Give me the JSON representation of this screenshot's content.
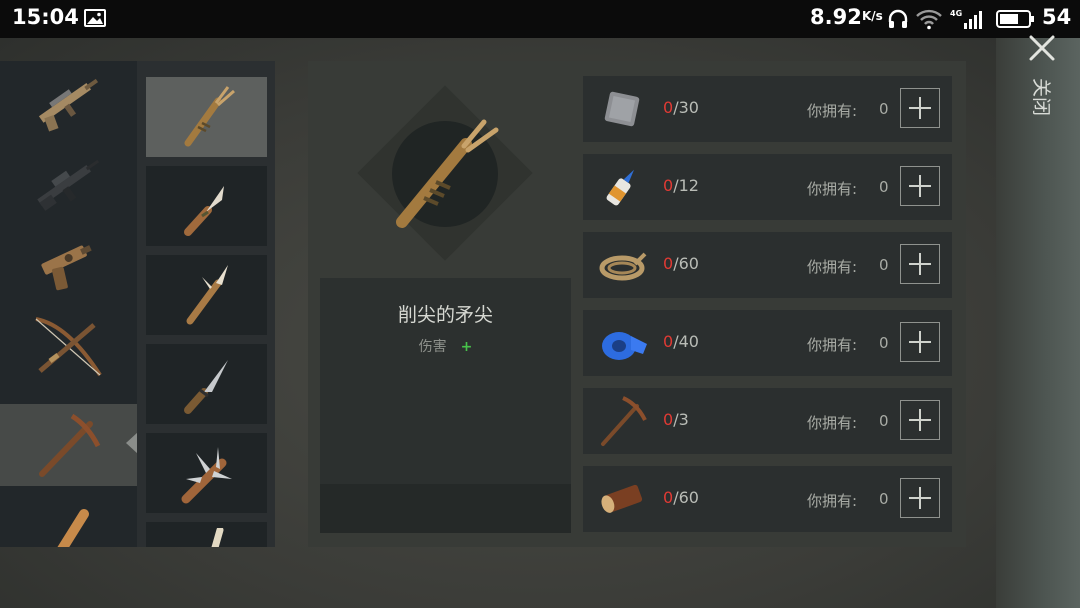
{
  "status_bar": {
    "time": "15:04",
    "speed": "8.92",
    "speed_unit": "K/s",
    "battery_level": "54",
    "icons": [
      "gallery-icon",
      "headset-icon",
      "wifi-icon",
      "signal-4g-icon",
      "battery-icon"
    ]
  },
  "categories": [
    {
      "name": "assault-rifle-icon",
      "selected": false
    },
    {
      "name": "m16-rifle-icon",
      "selected": false
    },
    {
      "name": "pistol-icon",
      "selected": false
    },
    {
      "name": "crossbow-icon",
      "selected": false
    },
    {
      "name": "pickaxe-icon",
      "selected": true
    },
    {
      "name": "bat-icon",
      "selected": false
    }
  ],
  "items": [
    {
      "name": "sharpened-spear-icon",
      "selected": true
    },
    {
      "name": "bone-knife-icon",
      "selected": false
    },
    {
      "name": "bone-spear-icon",
      "selected": false
    },
    {
      "name": "knife-icon",
      "selected": false
    },
    {
      "name": "spiked-club-icon",
      "selected": false
    },
    {
      "name": "bone-item-icon",
      "selected": false
    }
  ],
  "detail": {
    "item_name": "削尖的矛尖",
    "damage_label": "伤害",
    "damage_plus": "+"
  },
  "requirements": [
    {
      "icon": "metal-plate-icon",
      "have": "0",
      "need": "/30",
      "owned_label": "你拥有:",
      "owned_value": "0"
    },
    {
      "icon": "glue-bottle-icon",
      "have": "0",
      "need": "/12",
      "owned_label": "你拥有:",
      "owned_value": "0"
    },
    {
      "icon": "rope-icon",
      "have": "0",
      "need": "/60",
      "owned_label": "你拥有:",
      "owned_value": "0"
    },
    {
      "icon": "blue-tape-icon",
      "have": "0",
      "need": "/40",
      "owned_label": "你拥有:",
      "owned_value": "0"
    },
    {
      "icon": "pickaxe-icon",
      "have": "0",
      "need": "/3",
      "owned_label": "你拥有:",
      "owned_value": "0"
    },
    {
      "icon": "wood-log-icon",
      "have": "0",
      "need": "/60",
      "owned_label": "你拥有:",
      "owned_value": "0"
    }
  ],
  "close": {
    "label": "关闭"
  },
  "colors": {
    "shortage_red": "#e03a34",
    "damage_green": "#47c24a",
    "panel": "#383b37"
  }
}
